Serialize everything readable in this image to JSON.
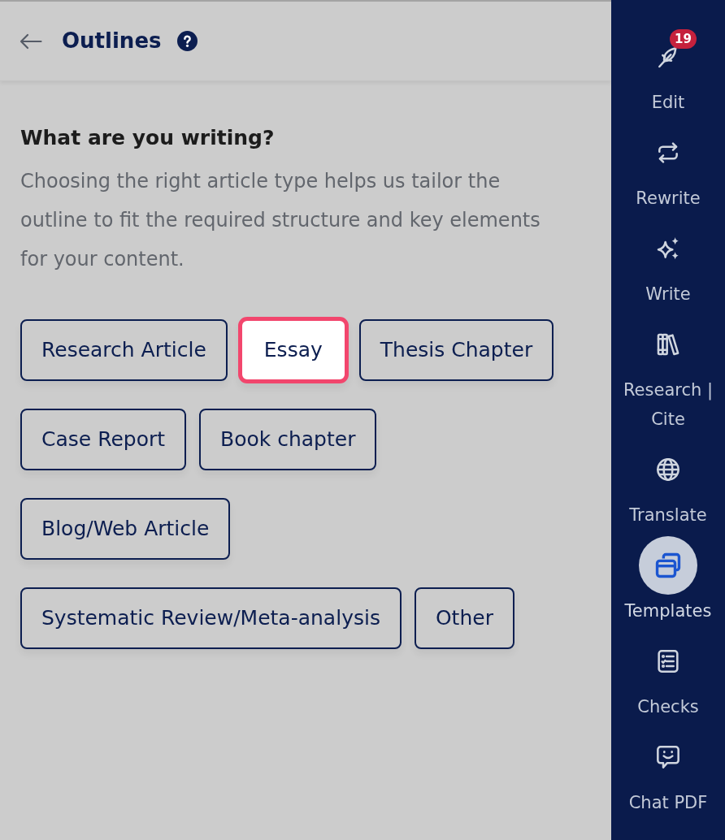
{
  "header": {
    "title": "Outlines"
  },
  "prompt": {
    "heading": "What are you writing?",
    "description": "Choosing the right article type helps us tailor the outline to fit the required structure and key elements for your content."
  },
  "article_types": [
    {
      "label": "Research Article",
      "selected": false
    },
    {
      "label": "Essay",
      "selected": true
    },
    {
      "label": "Thesis Chapter",
      "selected": false
    },
    {
      "label": "Case Report",
      "selected": false
    },
    {
      "label": "Book chapter",
      "selected": false
    },
    {
      "label": "Blog/Web Article",
      "selected": false
    },
    {
      "label": "Systematic Review/Meta-analysis",
      "selected": false
    },
    {
      "label": "Other",
      "selected": false
    }
  ],
  "sidebar": {
    "items": [
      {
        "label": "Edit",
        "badge": "19",
        "selected": false
      },
      {
        "label": "Rewrite",
        "selected": false
      },
      {
        "label": "Write",
        "selected": false
      },
      {
        "label": "Research | Cite",
        "selected": false
      },
      {
        "label": "Translate",
        "selected": false
      },
      {
        "label": "Templates",
        "selected": true
      },
      {
        "label": "Checks",
        "selected": false
      },
      {
        "label": "Chat PDF",
        "selected": false
      }
    ]
  }
}
